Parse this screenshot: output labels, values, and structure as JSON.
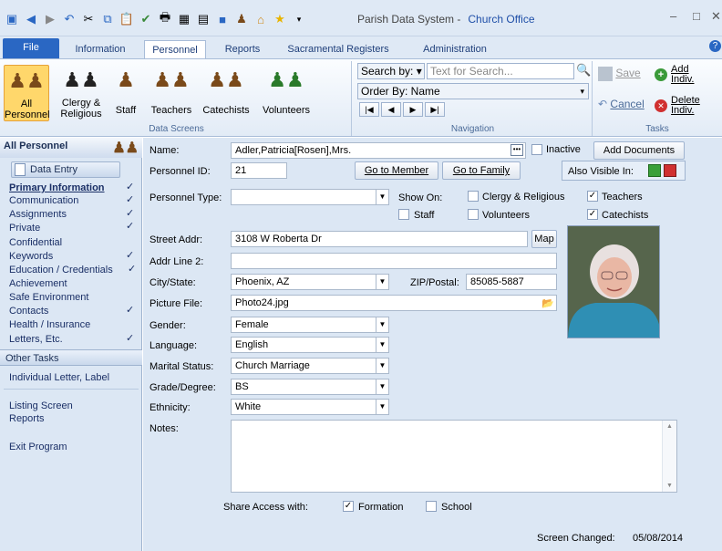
{
  "title": {
    "app": "Parish Data System -",
    "office": "Church Office"
  },
  "tabs": {
    "file": "File",
    "information": "Information",
    "personnel": "Personnel",
    "reports": "Reports",
    "sacramental": "Sacramental Registers",
    "administration": "Administration"
  },
  "ribbon": {
    "all": "All\nPersonnel",
    "clergy": "Clergy &\nReligious",
    "staff": "Staff",
    "teachers": "Teachers",
    "catechists": "Catechists",
    "volunteers": "Volunteers",
    "data_screens": "Data Screens",
    "search_by": "Search by:",
    "search_placeholder": "Text for Search...",
    "order_by": "Order By: Name",
    "navigation": "Navigation",
    "save": "Save",
    "add": "Add\nIndiv.",
    "cancel": "Cancel",
    "delete": "Delete\nIndiv.",
    "tasks": "Tasks"
  },
  "sidebar": {
    "header": "All Personnel",
    "data_entry": "Data Entry",
    "items": [
      "Primary Information",
      "Communication",
      "Assignments",
      "Private",
      "Confidential",
      "Keywords",
      "Education / Credentials",
      "Achievement",
      "Safe Environment",
      "Contacts",
      "Health / Insurance",
      "Letters, Etc."
    ],
    "other_tasks": "Other Tasks",
    "tasks": [
      "Individual Letter, Label",
      "Listing Screen",
      "Reports",
      "Exit Program"
    ]
  },
  "form": {
    "name_label": "Name:",
    "name": "Adler,Patricia[Rosen],Mrs.",
    "inactive": "Inactive",
    "add_documents": "Add Documents",
    "id_label": "Personnel ID:",
    "id": "21",
    "goto_member": "Go to Member",
    "goto_family": "Go to Family",
    "also_visible": "Also Visible In:",
    "type_label": "Personnel Type:",
    "show_on": "Show On:",
    "clergy": "Clergy & Religious",
    "teachers": "Teachers",
    "staff": "Staff",
    "volunteers": "Volunteers",
    "catechists": "Catechists",
    "street_label": "Street Addr:",
    "street": "3108 W Roberta Dr",
    "map": "Map",
    "line2_label": "Addr Line 2:",
    "city_label": "City/State:",
    "city": "Phoenix, AZ",
    "zip_label": "ZIP/Postal:",
    "zip": "85085-5887",
    "picture_label": "Picture File:",
    "picture": "Photo24.jpg",
    "gender_label": "Gender:",
    "gender": "Female",
    "language_label": "Language:",
    "language": "English",
    "marital_label": "Marital Status:",
    "marital": "Church Marriage",
    "grade_label": "Grade/Degree:",
    "grade": "BS",
    "ethnicity_label": "Ethnicity:",
    "ethnicity": "White",
    "notes_label": "Notes:",
    "share_label": "Share Access with:",
    "formation": "Formation",
    "school": "School",
    "changed_label": "Screen Changed:",
    "changed": "05/08/2014"
  }
}
